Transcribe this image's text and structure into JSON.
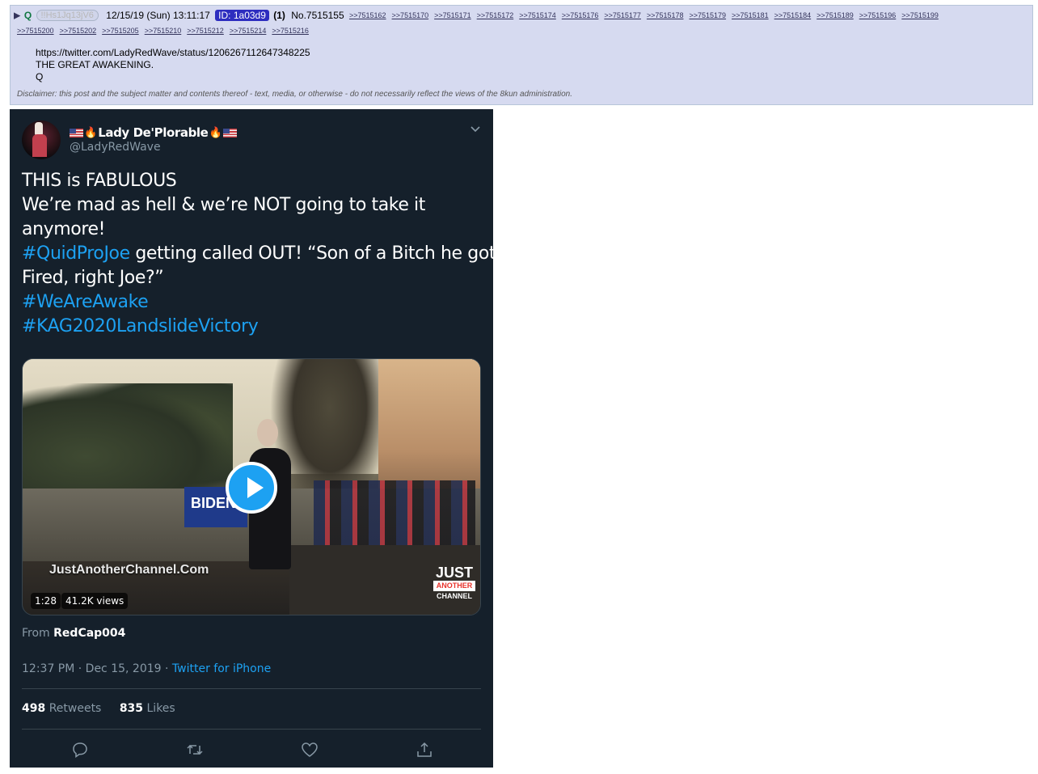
{
  "post": {
    "arrow": "▶",
    "name": "Q",
    "tripcode": "!!Hs1Jq13jV6",
    "datetime": "12/15/19 (Sun) 13:11:17",
    "id_label": "ID: 1a03d9",
    "post_count": "(1)",
    "post_number": "No.7515155",
    "backlinks": [
      ">>7515162",
      ">>7515170",
      ">>7515171",
      ">>7515172",
      ">>7515174",
      ">>7515176",
      ">>7515177",
      ">>7515178",
      ">>7515179",
      ">>7515181",
      ">>7515184",
      ">>7515189",
      ">>7515196",
      ">>7515199",
      ">>7515200",
      ">>7515202",
      ">>7515205",
      ">>7515210",
      ">>7515212",
      ">>7515214",
      ">>7515216"
    ],
    "body": [
      "https://twitter.com/LadyRedWave/status/1206267112647348225",
      "THE GREAT AWAKENING.",
      "Q"
    ],
    "disclaimer": "Disclaimer: this post and the subject matter and contents thereof - text, media, or otherwise - do not necessarily reflect the views of the 8kun administration."
  },
  "tweet": {
    "display_name": "Lady De'Plorable",
    "handle": "@LadyRedWave",
    "lines": [
      {
        "text": "THIS is FABULOUS"
      },
      {
        "text": "We’re mad as hell & we’re NOT going to take it"
      },
      {
        "text": "anymore!"
      },
      {
        "hashtag": "#QuidProJoe",
        "text": " getting called OUT! “Son of a Bitch he got"
      },
      {
        "text": "Fired, right Joe?”"
      },
      {
        "hashtag": "#WeAreAwake"
      },
      {
        "hashtag": "#KAG2020LandslideVictory"
      }
    ],
    "media": {
      "watermark": "JustAnotherChannel.Com",
      "sign_text": "BIDEN",
      "logo": [
        "JUST",
        "ANOTHER",
        "CHANNEL"
      ],
      "duration": "1:28",
      "views": "41.2K views"
    },
    "from_label": "From",
    "from_user": "RedCap004",
    "timestamp": "12:37 PM · Dec 15, 2019 ·",
    "source": "Twitter for iPhone",
    "retweets_count": "498",
    "retweets_label": "Retweets",
    "likes_count": "835",
    "likes_label": "Likes",
    "actions": [
      "reply-icon",
      "retweet-icon",
      "like-icon",
      "share-icon"
    ],
    "colors": {
      "background": "#15202b",
      "accent": "#1da1f2",
      "muted": "#8899a6"
    }
  }
}
